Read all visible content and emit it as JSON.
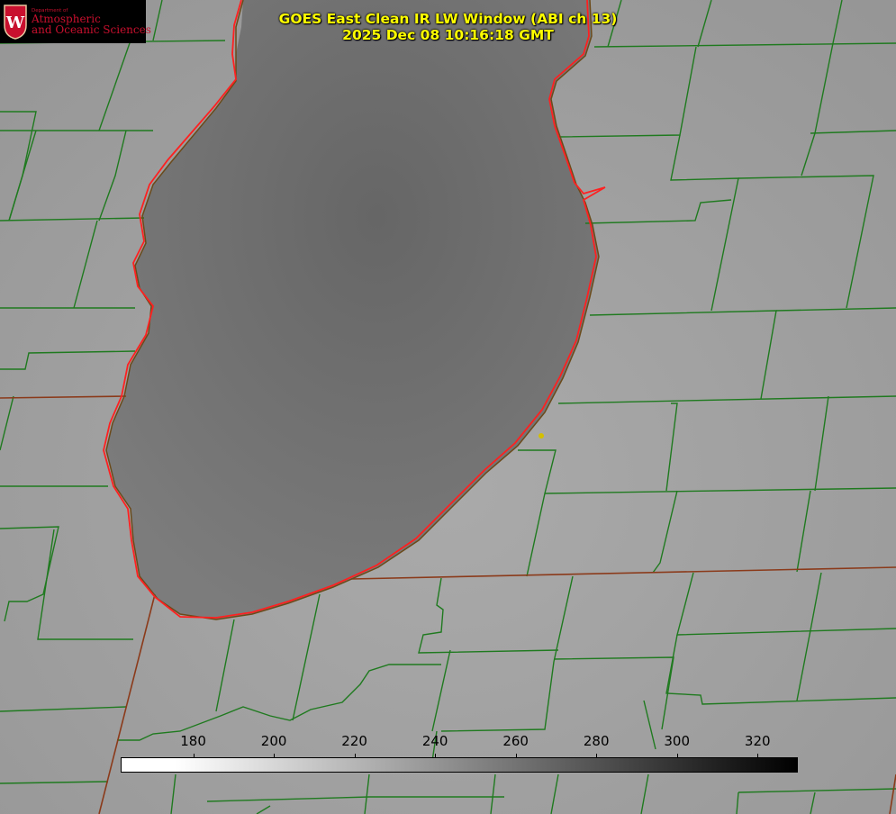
{
  "logo": {
    "seal_letter": "W",
    "dept": "Department of",
    "line1": "Atmospheric",
    "line2": "and Oceanic Sciences",
    "color": "#c8102e"
  },
  "title": {
    "line1": "GOES East Clean IR LW Window (ABI ch 13)",
    "line2": "2025 Dec 08 10:16:18 GMT",
    "color": "#ffff00"
  },
  "colorbar": {
    "ticks": [
      "180",
      "200",
      "220",
      "240",
      "260",
      "280",
      "300",
      "320"
    ],
    "tick_values": [
      180,
      200,
      220,
      240,
      260,
      280,
      300,
      320
    ],
    "range": [
      162,
      330
    ],
    "color_low": "#ffffff",
    "color_high": "#000000"
  },
  "map_colors": {
    "county_lines": "#1f7a1f",
    "state_lines": "#8b3a1a",
    "coastline": "#ff2020",
    "land": "#a4a4a4",
    "lake": "#707070",
    "marker": "#d4c000"
  }
}
